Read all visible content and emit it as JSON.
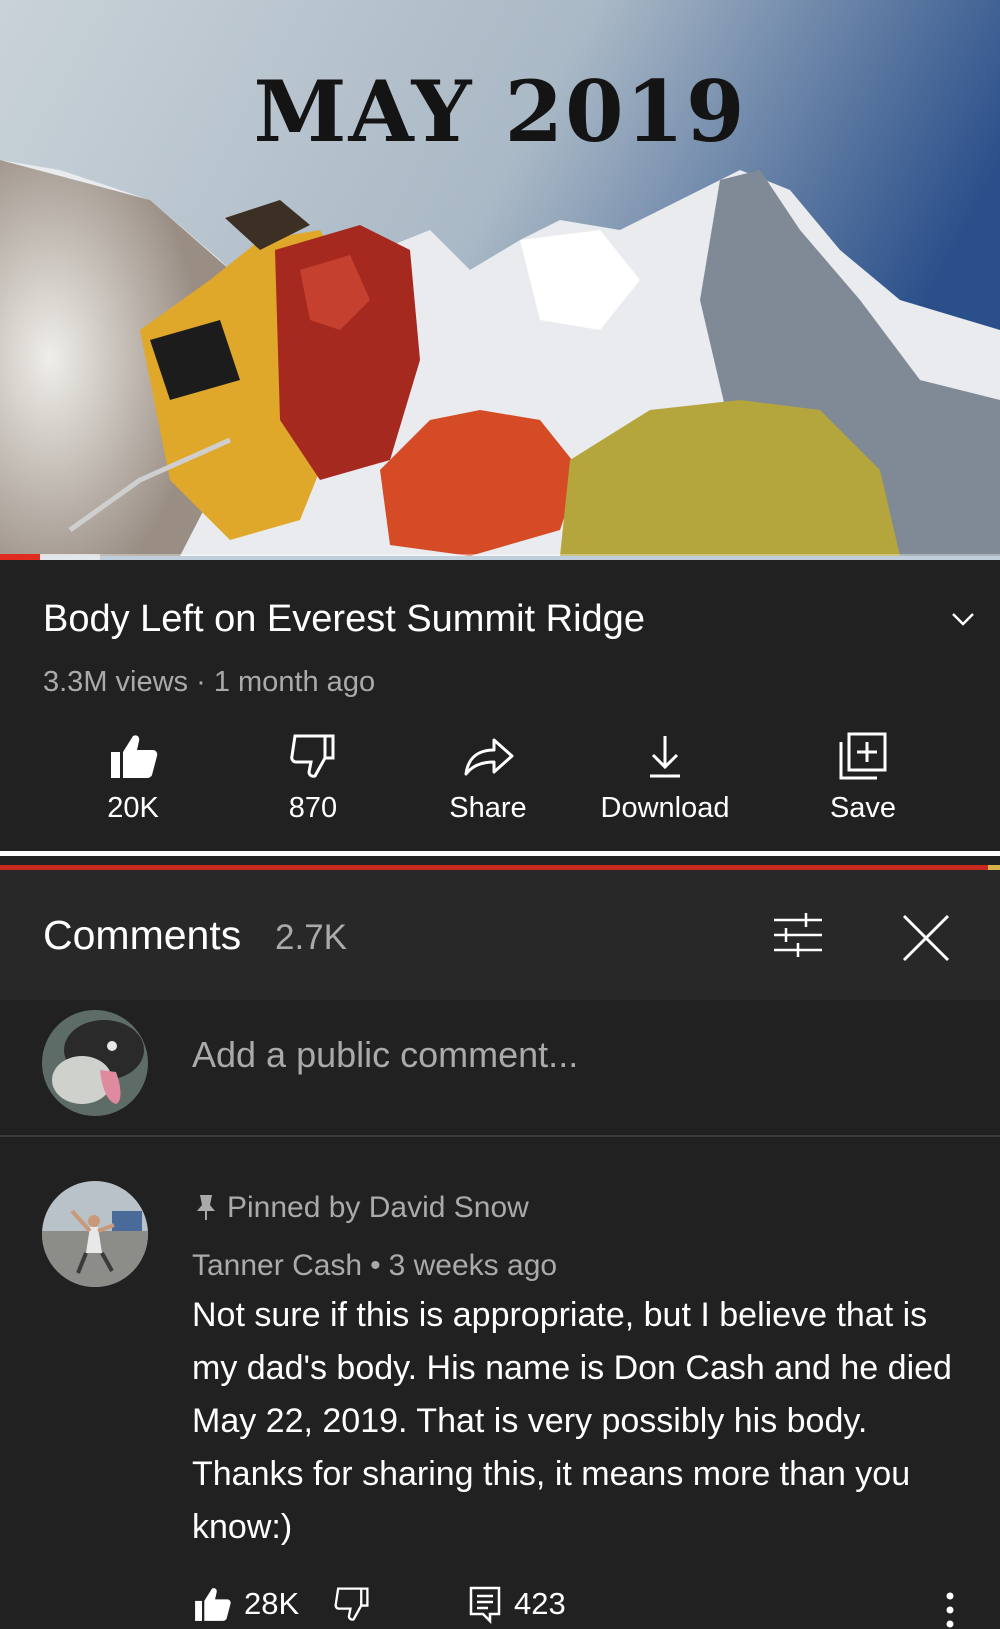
{
  "video": {
    "overlay_text": "MAY 2019",
    "progress_fraction": 0.04,
    "buffered_fraction": 0.1
  },
  "info": {
    "title": "Body Left on Everest Summit Ridge",
    "views": "3.3M views",
    "separator": "·",
    "age": "1 month ago",
    "actions": {
      "like": "20K",
      "dislike": "870",
      "share": "Share",
      "download": "Download",
      "save": "Save"
    }
  },
  "comments_header": {
    "title": "Comments",
    "count": "2.7K"
  },
  "add_comment": {
    "placeholder": "Add a public comment..."
  },
  "pinned_comment": {
    "pinned_label": "Pinned by David Snow",
    "author": "Tanner Cash",
    "bullet": "•",
    "age": "3 weeks ago",
    "text": "Not sure if this is appropriate, but I believe that is my dad's body. His name is Don Cash and he died May 22, 2019. That is very possibly his body. Thanks for sharing this, it means more than you know:)",
    "likes": "28K",
    "replies": "423"
  },
  "colors": {
    "background": "#212121",
    "header_background": "#282828",
    "secondary_text": "#aaaaaa",
    "progress_red": "#e12b1f"
  },
  "icons": [
    "thumbs-up-icon",
    "thumbs-down-icon",
    "share-icon",
    "download-icon",
    "save-icon",
    "expand-chevron-icon",
    "sort-icon",
    "close-icon",
    "pin-icon",
    "reply-icon",
    "more-icon"
  ]
}
